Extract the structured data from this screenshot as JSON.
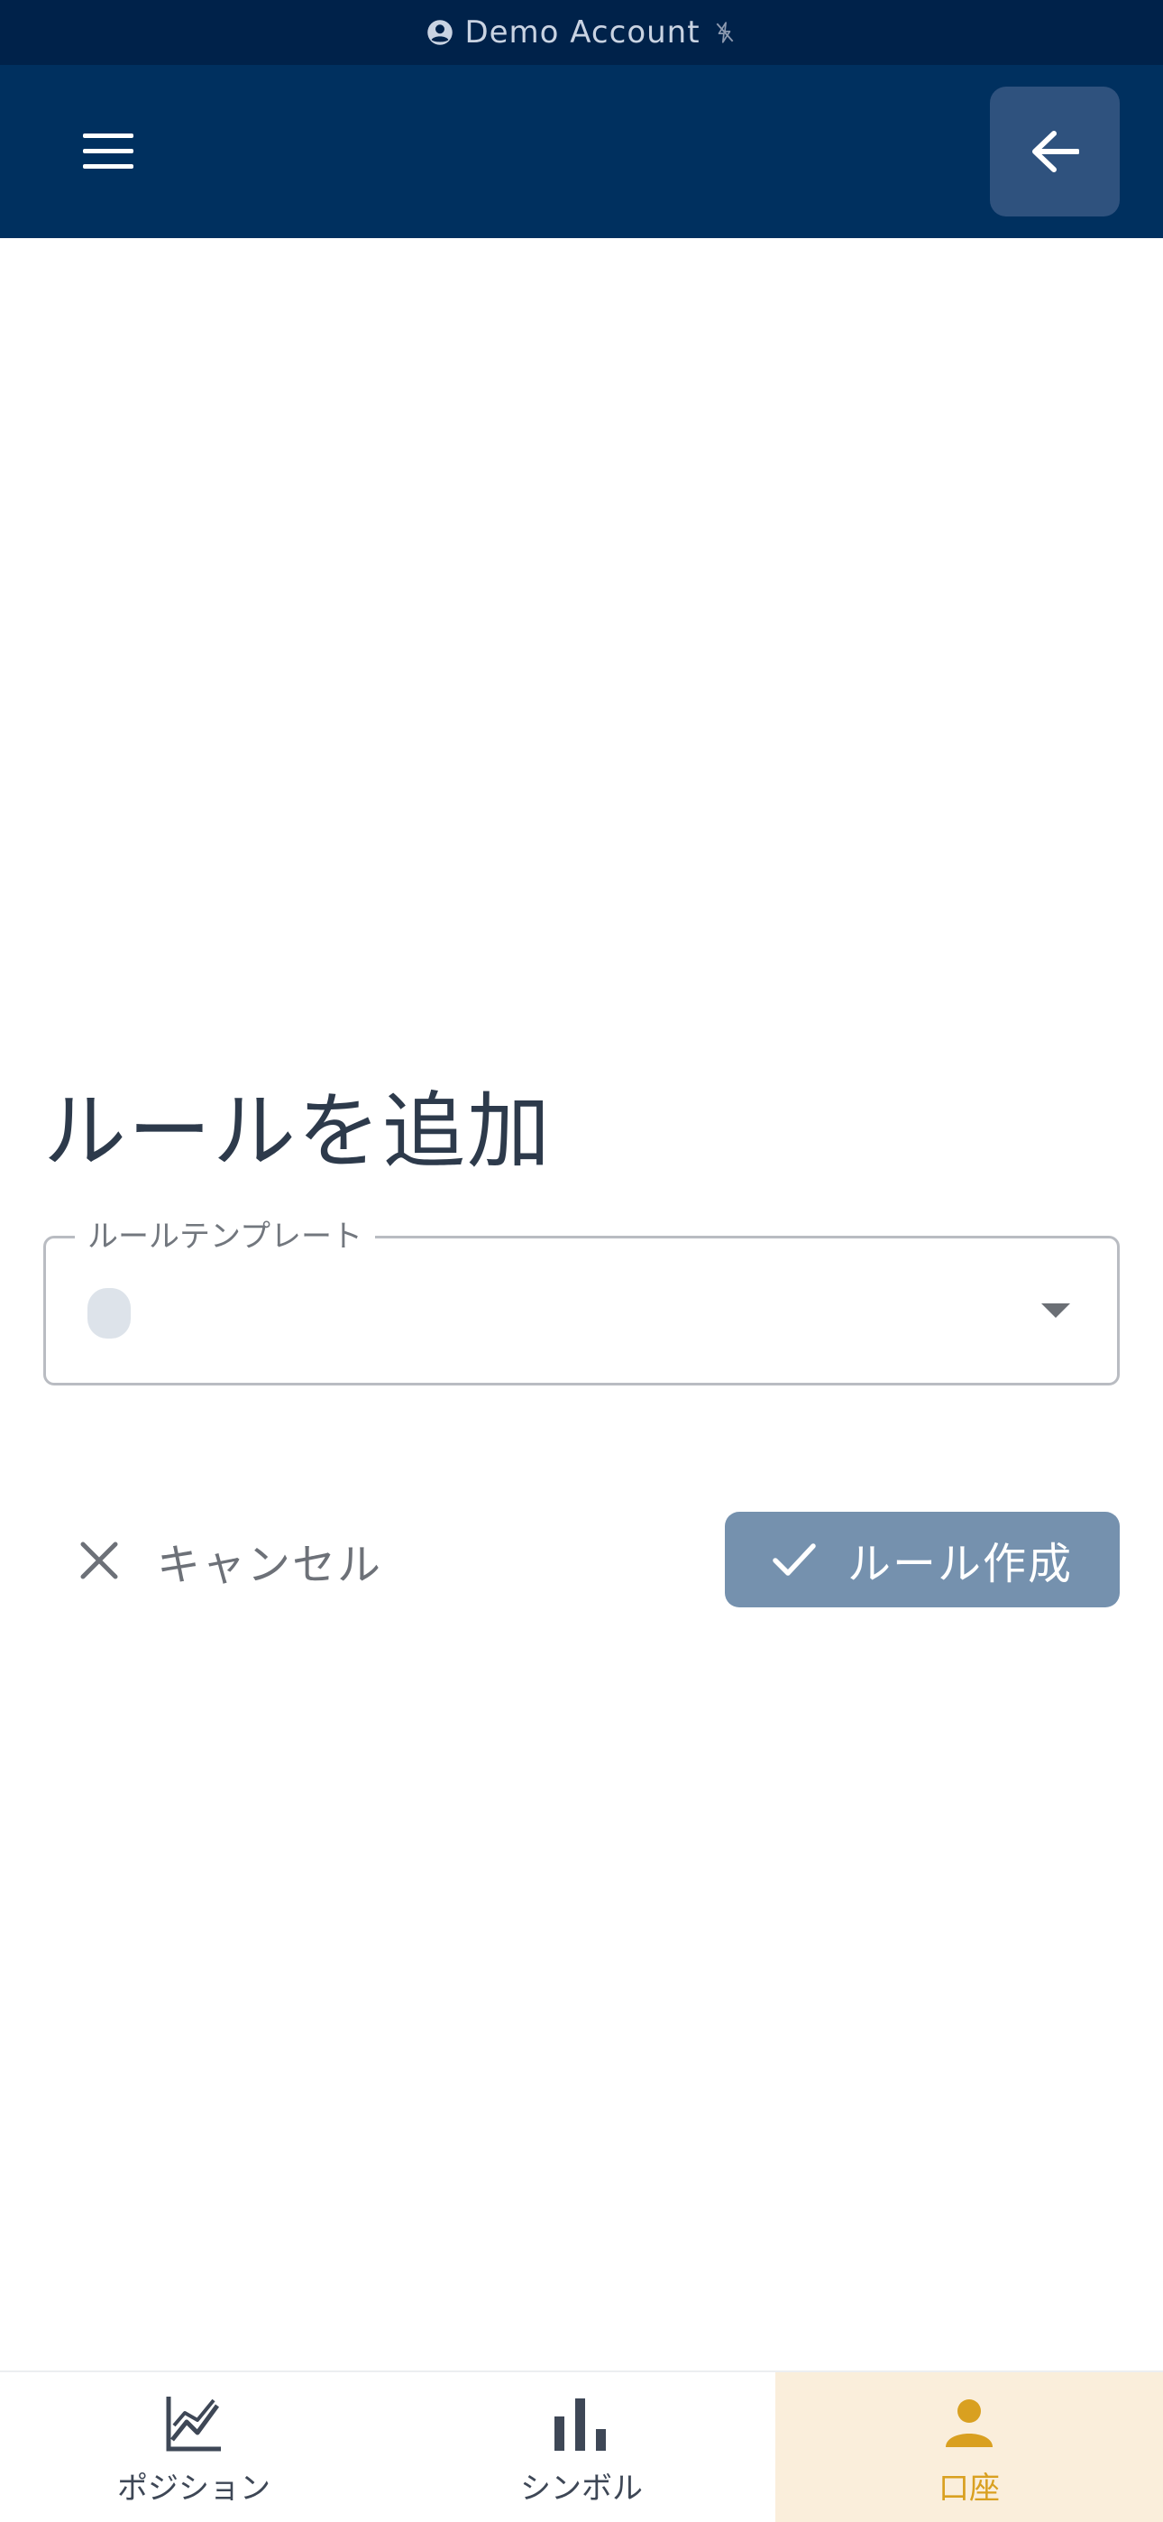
{
  "status_bar": {
    "account_label": "Demo Account",
    "icons": [
      "account-circle-icon",
      "offline-bolt-icon"
    ]
  },
  "app_bar": {
    "icons": [
      "menu-icon",
      "arrow-back-icon"
    ]
  },
  "page": {
    "title": "ルールを追加"
  },
  "rule_template_field": {
    "label": "ルールテンプレート",
    "value": ""
  },
  "actions": {
    "cancel_label": "キャンセル",
    "create_label": "ルール作成"
  },
  "bottom_nav": {
    "items": [
      {
        "label": "ポジション",
        "icon": "line-chart-icon",
        "active": false
      },
      {
        "label": "シンボル",
        "icon": "bar-chart-icon",
        "active": false
      },
      {
        "label": "口座",
        "icon": "person-icon",
        "active": true
      }
    ]
  },
  "colors": {
    "status_bar_bg": "#00224a",
    "app_bar_bg": "#00305f",
    "back_button_bg": "#2f527e",
    "primary_button_bg": "#7591ae",
    "active_nav_bg": "#faeedb",
    "active_nav_fg": "#d9a020",
    "title_text": "#2d3a4b"
  }
}
